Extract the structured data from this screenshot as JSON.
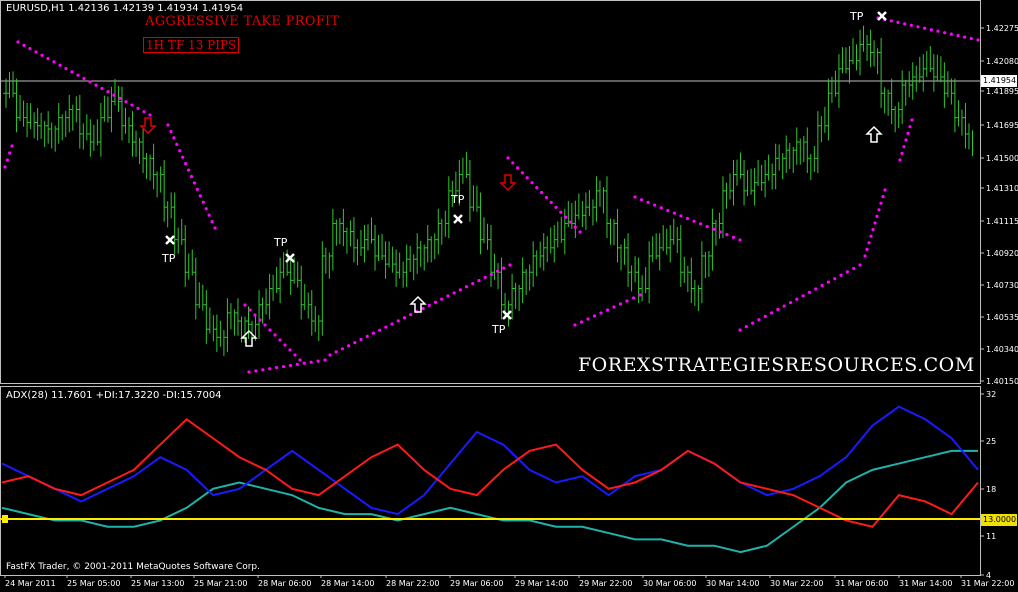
{
  "header": {
    "symbol_line": "EURUSD,H1  1.42136 1.42139 1.41934 1.41954",
    "strategy_title": "AGGRESSIVE TAKE PROFIT",
    "strategy_sub": "1H TF 13 PIPS"
  },
  "watermark": "FOREXSTRATEGIESRESOURCES.COM",
  "current_price": "1.41954",
  "adx_header": "ADX(28) 11.7601 +DI:17.3220 -DI:15.7004",
  "adx_level_label": "13.0000",
  "copyright": "FastFX Trader, © 2001-2011 MetaQuotes Software Corp.",
  "signal_label": "TP",
  "colors": {
    "candles": "#2fc82f",
    "sar": "#ff00ff",
    "adx": "#20b2aa",
    "plus_di": "#1a1aff",
    "minus_di": "#ff1a1a",
    "level": "#ffeb00",
    "background": "#000000"
  },
  "chart_data": [
    {
      "type": "line",
      "title": "EURUSD,H1",
      "y_ticks": [
        "1.42275",
        "1.42080",
        "1.41954",
        "1.41895",
        "1.41695",
        "1.41500",
        "1.41310",
        "1.41115",
        "1.40920",
        "1.40730",
        "1.40535",
        "1.40340",
        "1.40150"
      ],
      "ylim": [
        1.4015,
        1.4235
      ],
      "x_ticks": [
        "24 Mar 2011",
        "25 Mar 05:00",
        "25 Mar 13:00",
        "25 Mar 21:00",
        "28 Mar 06:00",
        "28 Mar 14:00",
        "28 Mar 22:00",
        "29 Mar 06:00",
        "29 Mar 14:00",
        "29 Mar 22:00",
        "30 Mar 06:00",
        "30 Mar 14:00",
        "30 Mar 22:00",
        "31 Mar 06:00",
        "31 Mar 14:00",
        "31 Mar 22:00"
      ],
      "series": [
        {
          "name": "close",
          "values": [
            1.419,
            1.4175,
            1.4172,
            1.417,
            1.4168,
            1.4175,
            1.418,
            1.4165,
            1.416,
            1.4175,
            1.4185,
            1.417,
            1.416,
            1.415,
            1.414,
            1.412,
            1.41,
            1.408,
            1.406,
            1.4045,
            1.404,
            1.4055,
            1.405,
            1.4048,
            1.406,
            1.407,
            1.408,
            1.4075,
            1.406,
            1.405,
            1.409,
            1.411,
            1.4105,
            1.4095,
            1.41,
            1.409,
            1.4085,
            1.408,
            1.4088,
            1.4095,
            1.41,
            1.411,
            1.413,
            1.414,
            1.412,
            1.41,
            1.408,
            1.406,
            1.407,
            1.408,
            1.409,
            1.4095,
            1.41,
            1.411,
            1.4115,
            1.412,
            1.413,
            1.411,
            1.4095,
            1.408,
            1.407,
            1.409,
            1.4095,
            1.41,
            1.408,
            1.407,
            1.409,
            1.411,
            1.413,
            1.414,
            1.413,
            1.4135,
            1.414,
            1.415,
            1.4155,
            1.416,
            1.415,
            1.417,
            1.419,
            1.4205,
            1.421,
            1.422,
            1.4215,
            1.419,
            1.418,
            1.4195,
            1.42,
            1.4205,
            1.42,
            1.419,
            1.4175,
            1.4165
          ]
        },
        {
          "name": "Parabolic SAR",
          "values": []
        }
      ]
    },
    {
      "type": "line",
      "title": "ADX(28) 11.7601 +DI:17.3220 -DI:15.7004",
      "ylim": [
        4,
        32
      ],
      "y_ticks": [
        "32",
        "25",
        "18",
        "13.0000",
        "11",
        "4"
      ],
      "series": [
        {
          "name": "ADX",
          "values": [
            14,
            13,
            12,
            12,
            11,
            11,
            12,
            14,
            17,
            18,
            17,
            16,
            14,
            13,
            13,
            12,
            13,
            14,
            13,
            12,
            12,
            11,
            11,
            10,
            9,
            9,
            8,
            8,
            7,
            8,
            11,
            14,
            18,
            20,
            21,
            22,
            23,
            23
          ]
        },
        {
          "name": "+DI",
          "values": [
            21,
            19,
            17,
            15,
            17,
            19,
            22,
            20,
            16,
            17,
            20,
            23,
            20,
            17,
            14,
            13,
            16,
            21,
            26,
            24,
            20,
            18,
            19,
            16,
            19,
            20,
            23,
            21,
            18,
            16,
            17,
            19,
            22,
            27,
            30,
            28,
            25,
            20
          ]
        },
        {
          "name": "-DI",
          "values": [
            18,
            19,
            17,
            16,
            18,
            20,
            24,
            28,
            25,
            22,
            20,
            17,
            16,
            19,
            22,
            24,
            20,
            17,
            16,
            20,
            23,
            24,
            20,
            17,
            18,
            20,
            23,
            21,
            18,
            17,
            16,
            14,
            12,
            11,
            16,
            15,
            13,
            18
          ]
        }
      ],
      "levels": [
        13
      ]
    }
  ]
}
